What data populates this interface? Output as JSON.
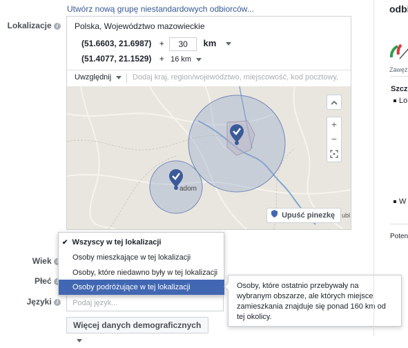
{
  "audience": {
    "create_link": "Utwórz nową grupę niestandardowych odbiorców..."
  },
  "location": {
    "label": "Lokalizacje",
    "region": "Polska, Województwo mazowieckie",
    "pins": [
      {
        "coords": "(51.6603, 21.6987)",
        "plus": "+",
        "radius_value": "30",
        "radius_unit": "km"
      },
      {
        "coords": "(51.4077, 21.1529)",
        "plus": "+",
        "radius_select": "16 km"
      }
    ],
    "include_dropdown": "Uwzględnij",
    "search_placeholder": "Dodaj kraj, region/województwo, miejscowość, kod pocztowy,",
    "map": {
      "city_label": "adom",
      "drop_pin_button": "Upuść pinezkę",
      "zoom_in": "+",
      "zoom_out": "−",
      "collapse": "^",
      "attribution": "ubl"
    }
  },
  "demographics": {
    "age_label": "Wiek",
    "gender_label": "Płeć",
    "languages_label": "Języki",
    "languages_placeholder": "Podaj język...",
    "more_button": "Więcej danych demograficznych"
  },
  "location_type_menu": {
    "items": [
      {
        "label": "Wszyscy w tej lokalizacji",
        "checked": true,
        "highlighted": false
      },
      {
        "label": "Osoby mieszkające w tej lokalizacji",
        "checked": false,
        "highlighted": false
      },
      {
        "label": "Osoby, które niedawno były w tej lokalizacji",
        "checked": false,
        "highlighted": false
      },
      {
        "label": "Osoby podróżujące w tej lokalizacji",
        "checked": false,
        "highlighted": true
      }
    ],
    "check_glyph": "✔"
  },
  "tooltip": {
    "text": "Osoby, które ostatnio przebywały na wybranym obszarze, ale których miejsce zamieszkania znajduje się ponad 160 km od tej okolicy."
  },
  "right_panel": {
    "title": "odbi",
    "gauge_caption": "Zawęż",
    "section_title": "Szcz",
    "bullet1": "Lo",
    "bullet2": "W",
    "potential": "Poten"
  },
  "colors": {
    "accent": "#4267b2",
    "link": "#365899",
    "highlight": "#4267b2"
  }
}
